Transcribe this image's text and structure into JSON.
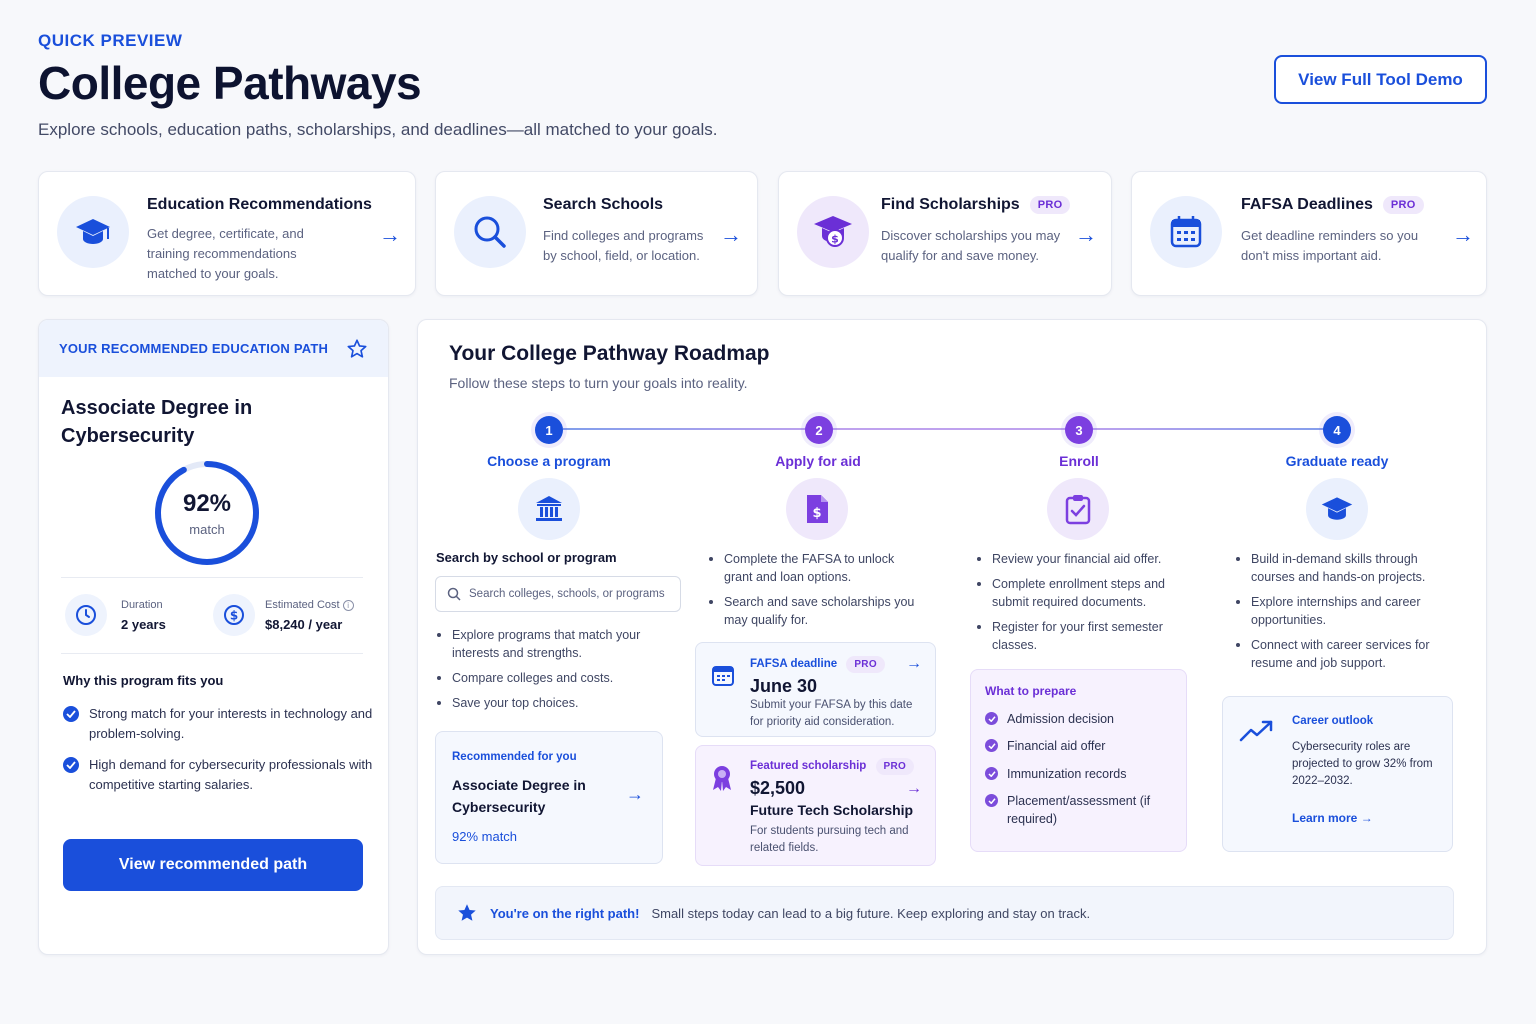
{
  "header": {
    "eyebrow": "QUICK PREVIEW",
    "title": "College Pathways",
    "subtitle": "Explore schools, education paths, scholarships, and deadlines—all matched to your goals.",
    "demo_button": "View Full Tool Demo"
  },
  "features": [
    {
      "title": "Education Recommendations",
      "pro": "",
      "desc_lines": [
        "Get degree, certificate, and",
        "training recommendations",
        "matched to your goals."
      ],
      "icon": "graduation-cap-icon"
    },
    {
      "title": "Search Schools",
      "pro": "",
      "desc_lines": [
        "Find colleges and programs",
        "by school, field, or location."
      ],
      "icon": "search-icon"
    },
    {
      "title": "Find Scholarships",
      "pro": "PRO",
      "desc_lines": [
        "Discover scholarships you may",
        "qualify for and save money."
      ],
      "icon": "scholarship-cap-icon"
    },
    {
      "title": "FAFSA Deadlines",
      "pro": "PRO",
      "desc_lines": [
        "Get deadline reminders so you",
        "don't miss important aid."
      ],
      "icon": "calendar-icon"
    }
  ],
  "recommended": {
    "header": "YOUR RECOMMENDED EDUCATION PATH",
    "degree_line1": "Associate Degree in",
    "degree_line2": "Cybersecurity",
    "match_pct": "92%",
    "match_value": 0.92,
    "match_label": "match",
    "duration_label": "Duration",
    "duration_value": "2 years",
    "cost_label": "Estimated Cost",
    "cost_value": "$8,240 / year",
    "why_title": "Why this program fits you",
    "reasons": [
      "Strong match for your interests in technology and problem-solving.",
      "High demand for cybersecurity professionals with competitive starting salaries."
    ],
    "button": "View recommended path"
  },
  "roadmap": {
    "title": "Your College Pathway Roadmap",
    "subtitle": "Follow these steps to turn your goals into reality.",
    "steps": [
      {
        "num": "1",
        "label": "Choose a program"
      },
      {
        "num": "2",
        "label": "Apply for aid"
      },
      {
        "num": "3",
        "label": "Enroll"
      },
      {
        "num": "4",
        "label": "Graduate ready"
      }
    ],
    "step1": {
      "search_label": "Search by school or program",
      "search_placeholder": "Search colleges, schools, or programs",
      "bullets": [
        "Explore programs that match your interests and strengths.",
        "Compare colleges and costs.",
        "Save your top choices."
      ],
      "rec_small": "Recommended for you",
      "rec_line1": "Associate Degree in",
      "rec_line2": "Cybersecurity",
      "rec_match": "92% match"
    },
    "step2": {
      "bullets": [
        "Complete the FAFSA to unlock grant and loan options.",
        "Search and save scholarships you may qualify for."
      ],
      "fafsa_small": "FAFSA deadline",
      "fafsa_pro": "PRO",
      "fafsa_date": "June 30",
      "fafsa_desc": "Submit your FAFSA by this date for priority aid consideration.",
      "sch_small": "Featured scholarship",
      "sch_pro": "PRO",
      "sch_amount": "$2,500",
      "sch_name": "Future Tech Scholarship",
      "sch_desc": "For students pursuing tech and related fields."
    },
    "step3": {
      "bullets": [
        "Review your financial aid offer.",
        "Complete enrollment steps and submit required documents.",
        "Register for your first semester classes."
      ],
      "prep_title": "What to prepare",
      "prep_items": [
        "Admission decision",
        "Financial aid offer",
        "Immunization records",
        "Placement/assessment (if required)"
      ]
    },
    "step4": {
      "bullets": [
        "Build in-demand skills through courses and hands-on projects.",
        "Explore internships and career opportunities.",
        "Connect with career services for resume and job support."
      ],
      "career_small": "Career outlook",
      "career_desc": "Cybersecurity roles are projected to grow 32% from 2022–2032.",
      "learn_more": "Learn more"
    },
    "banner_bold": "You're on the right path!",
    "banner_text": "Small steps today can lead to a big future. Keep exploring and stay on track."
  },
  "colors": {
    "accent": "#1a4fdb",
    "purple": "#6b2fd6"
  }
}
